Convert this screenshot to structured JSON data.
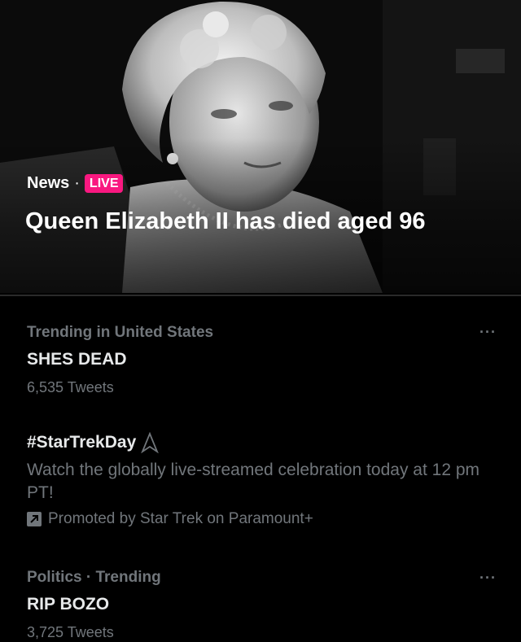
{
  "hero": {
    "category": "News",
    "separator": "·",
    "badge": "LIVE",
    "headline": "Queen Elizabeth II has died aged 96",
    "badge_color": "#f91880"
  },
  "trends": [
    {
      "meta": "Trending in United States",
      "title": "SHES DEAD",
      "count": "6,535 Tweets",
      "more_icon": "more-horizontal-icon"
    },
    {
      "title": "#StarTrekDay",
      "hashtag_icon": "star-trek-delta-icon",
      "description": "Watch the globally live-streamed celebration today at 12 pm PT!",
      "promoted": "Promoted by Star Trek on Paramount+",
      "promoted_icon": "promoted-arrow-icon"
    },
    {
      "meta": "Politics · Trending",
      "title": "RIP BOZO",
      "count": "3,725 Tweets",
      "more_icon": "more-horizontal-icon"
    }
  ],
  "colors": {
    "background": "#000000",
    "primary_text": "#e7e9ea",
    "secondary_text": "#71767b",
    "accent_live": "#f91880"
  }
}
